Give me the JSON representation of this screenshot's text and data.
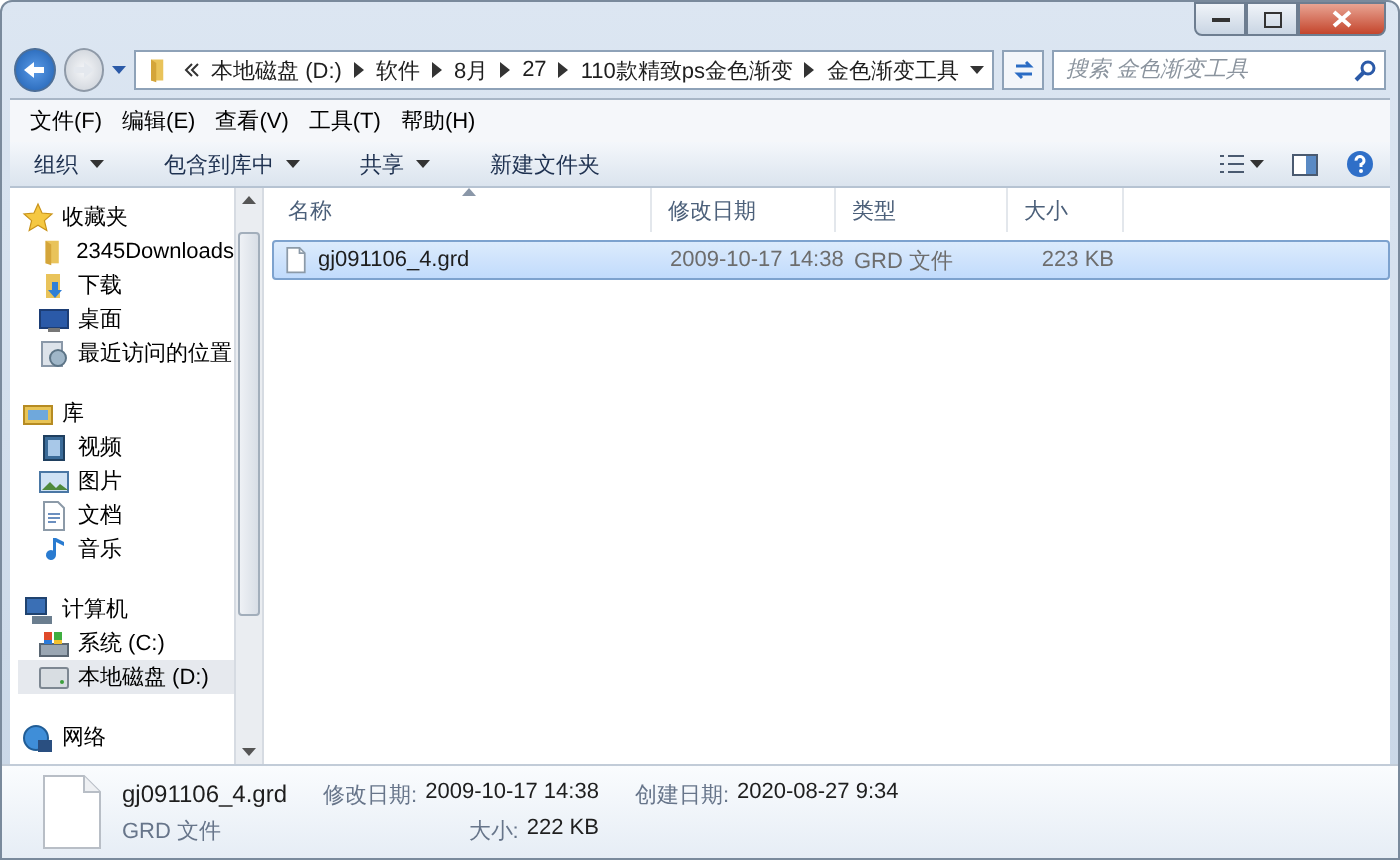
{
  "address": {
    "segments": [
      "本地磁盘 (D:)",
      "软件",
      "8月",
      "27",
      "110款精致ps金色渐变",
      "金色渐变工具"
    ]
  },
  "search": {
    "placeholder": "搜索 金色渐变工具"
  },
  "menu": [
    "文件(F)",
    "编辑(E)",
    "查看(V)",
    "工具(T)",
    "帮助(H)"
  ],
  "toolbar": [
    {
      "label": "组织",
      "has_menu": true
    },
    {
      "label": "包含到库中",
      "has_menu": true
    },
    {
      "label": "共享",
      "has_menu": true
    },
    {
      "label": "新建文件夹",
      "has_menu": false
    }
  ],
  "sidebar": {
    "groups": [
      {
        "label": "收藏夹",
        "kind": "star",
        "items": [
          {
            "label": "2345Downloads",
            "kind": "folder",
            "selected": false
          },
          {
            "label": "下载",
            "kind": "download",
            "selected": false
          },
          {
            "label": "桌面",
            "kind": "desktop",
            "selected": false
          },
          {
            "label": "最近访问的位置",
            "kind": "recent",
            "selected": false
          }
        ]
      },
      {
        "label": "库",
        "kind": "library",
        "items": [
          {
            "label": "视频",
            "kind": "video",
            "selected": false
          },
          {
            "label": "图片",
            "kind": "picture",
            "selected": false
          },
          {
            "label": "文档",
            "kind": "document",
            "selected": false
          },
          {
            "label": "音乐",
            "kind": "music",
            "selected": false
          }
        ]
      },
      {
        "label": "计算机",
        "kind": "computer",
        "items": [
          {
            "label": "系统 (C:)",
            "kind": "system-drive",
            "selected": false
          },
          {
            "label": "本地磁盘 (D:)",
            "kind": "drive",
            "selected": true
          }
        ]
      },
      {
        "label": "网络",
        "kind": "network"
      }
    ]
  },
  "table": {
    "columns": [
      {
        "label": "名称",
        "sorted": true
      },
      {
        "label": "修改日期",
        "sorted": false
      },
      {
        "label": "类型",
        "sorted": false
      },
      {
        "label": "大小",
        "sorted": false
      }
    ],
    "rows": [
      {
        "name": "gj091106_4.grd",
        "modified": "2009-10-17 14:38",
        "type": "GRD 文件",
        "size": "223 KB",
        "selected": true
      }
    ]
  },
  "details": {
    "name": "gj091106_4.grd",
    "modified_label": "修改日期:",
    "modified": "2009-10-17 14:38",
    "created_label": "创建日期:",
    "created": "2020-08-27 9:34",
    "type": "GRD 文件",
    "size_label": "大小:",
    "size": "222 KB"
  }
}
